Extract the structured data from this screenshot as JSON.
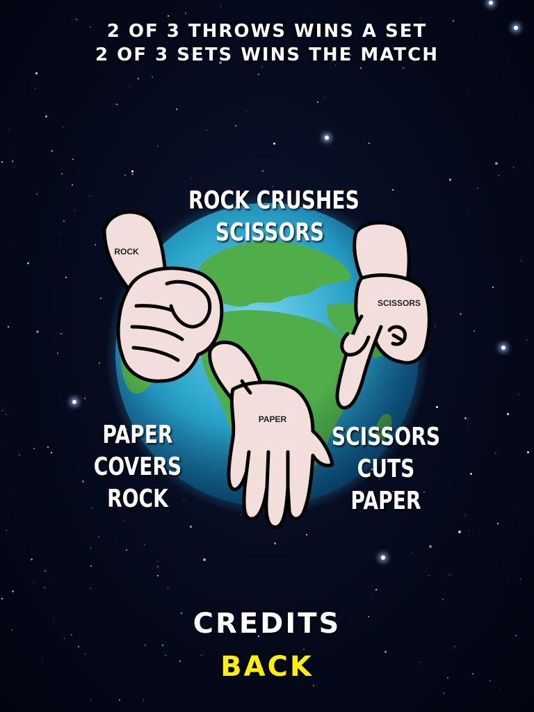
{
  "rules": {
    "line1": "2 OF 3 THROWS WINS A SET",
    "line2": "2 OF 3 SETS WINS THE MATCH"
  },
  "captions": {
    "rock": [
      "ROCK CRUSHES",
      "SCISSORS"
    ],
    "paper": [
      "PAPER",
      "COVERS",
      "ROCK"
    ],
    "scissors": [
      "SCISSORS",
      "CUTS",
      "PAPER"
    ]
  },
  "hand_labels": {
    "rock": "ROCK",
    "paper": "PAPER",
    "scissors": "SCISSORS"
  },
  "menu": {
    "credits_label": "CREDITS",
    "back_label": "BACK"
  },
  "colors": {
    "background": "#050a1c",
    "text": "#ffffff",
    "back_button": "#ffef00",
    "hand_fill": "#f2dfdc",
    "globe_ocean": "#2aa3c9",
    "globe_land": "#4fae4a"
  }
}
